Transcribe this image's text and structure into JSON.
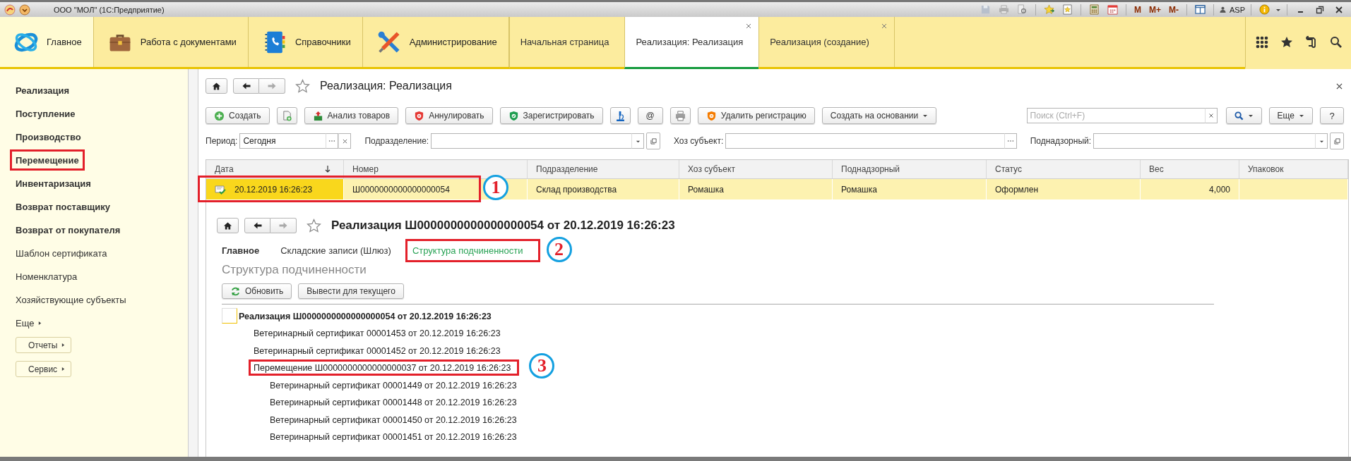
{
  "title_bar": {
    "title": "ООО \"МОЛ\"  (1С:Предприятие)",
    "memory_buttons": [
      "M",
      "M+",
      "M-"
    ],
    "user": "ASP"
  },
  "sections": [
    {
      "label": "Главное",
      "kind": "logo",
      "selected": true
    },
    {
      "label": "Работа с документами",
      "kind": "briefcase",
      "selected": false
    },
    {
      "label": "Справочники",
      "kind": "book",
      "selected": false
    },
    {
      "label": "Администрирование",
      "kind": "tools",
      "selected": false
    }
  ],
  "open_tabs": [
    {
      "label": "Начальная страница",
      "selected": false,
      "closable": false
    },
    {
      "label": "Реализация: Реализация",
      "selected": true,
      "closable": true
    },
    {
      "label": "Реализация (создание)",
      "selected": false,
      "closable": true
    }
  ],
  "sidebar": {
    "items": [
      {
        "label": "Реализация",
        "bold": true,
        "outlined": false
      },
      {
        "label": "Поступление",
        "bold": true,
        "outlined": false
      },
      {
        "label": "Производство",
        "bold": true,
        "outlined": false
      },
      {
        "label": "Перемещение",
        "bold": true,
        "outlined": true
      },
      {
        "label": "Инвентаризация",
        "bold": true,
        "outlined": false
      },
      {
        "label": "Возврат поставщику",
        "bold": true,
        "outlined": false
      },
      {
        "label": "Возврат от покупателя",
        "bold": true,
        "outlined": false
      },
      {
        "label": "Шаблон сертификата",
        "bold": false,
        "outlined": false
      },
      {
        "label": "Номенклатура",
        "bold": false,
        "outlined": false
      },
      {
        "label": "Хозяйствующие субъекты",
        "bold": false,
        "outlined": false
      }
    ],
    "more": "Еще",
    "buttons": [
      "Отчеты",
      "Сервис"
    ]
  },
  "list_form": {
    "title": "Реализация: Реализация",
    "favorite": false,
    "toolbar": [
      {
        "kind": "create",
        "label": "Создать"
      },
      {
        "kind": "copy"
      },
      {
        "kind": "analysis",
        "label": "Анализ товаров"
      },
      {
        "kind": "cancel",
        "label": "Аннулировать"
      },
      {
        "kind": "register",
        "label": "Зарегистрировать"
      },
      {
        "kind": "microscope"
      },
      {
        "kind": "text",
        "label": "@"
      },
      {
        "kind": "print"
      },
      {
        "kind": "unregister",
        "label": "Удалить регистрацию"
      },
      {
        "kind": "menu",
        "label": "Создать на основании"
      }
    ],
    "search": {
      "placeholder": "Поиск (Ctrl+F)"
    },
    "more_button": "Еще",
    "help_button": "?",
    "filters": [
      {
        "label": "Период:",
        "value": "Сегодня",
        "kind": "choice"
      },
      {
        "label": "Подразделение:",
        "kind": "dropdown"
      },
      {
        "label": "Хоз субъект:",
        "kind": "choice"
      },
      {
        "label": "Поднадзорный:",
        "kind": "dropdown"
      }
    ],
    "table": {
      "columns": [
        {
          "label": "Дата",
          "sorted_descending": true
        },
        {
          "label": "Номер"
        },
        {
          "label": "Подразделение"
        },
        {
          "label": "Хоз субъект"
        },
        {
          "label": "Поднадзорный"
        },
        {
          "label": "Статус"
        },
        {
          "label": "Вес",
          "kind": "number"
        },
        {
          "label": "Упаковок",
          "kind": "number"
        }
      ],
      "rows": [
        {
          "selected": true,
          "posted": true,
          "callout": "1",
          "cells": [
            {
              "text": "20.12.2019 16:26:23",
              "current": true
            },
            {
              "text": "Ш0000000000000000054",
              "current": false
            },
            {
              "text": "Склад производства",
              "current": false
            },
            {
              "text": "Ромашка",
              "current": false
            },
            {
              "text": "Ромашка",
              "current": false
            },
            {
              "text": "Оформлен",
              "current": false
            },
            {
              "text": "4,000",
              "current": false
            },
            {
              "current": false
            }
          ]
        }
      ]
    }
  },
  "document_form": {
    "title": "Реализация Ш0000000000000000054 от 20.12.2019 16:26:23",
    "favorite": false,
    "nav": [
      {
        "label": "Главное",
        "bold": true,
        "selected": false,
        "outlined": false
      },
      {
        "label": "Складские записи (Шлюз)",
        "bold": false,
        "selected": false,
        "outlined": false
      },
      {
        "label": "Структура подчиненности",
        "bold": false,
        "selected": true,
        "outlined": true,
        "callout": "2"
      }
    ],
    "heading": "Структура подчиненности",
    "buttons": [
      {
        "kind": "refresh",
        "label": "Обновить"
      },
      {
        "kind": "plain",
        "label": "Вывести для текущего"
      }
    ],
    "tree": [
      {
        "label": "Реализация Ш0000000000000000054 от 20.12.2019 16:26:23",
        "current": true,
        "outlined": false,
        "children": [
          {
            "label": "Ветеринарный сертификат 00001453 от 20.12.2019 16:26:23",
            "current": false,
            "outlined": false
          },
          {
            "label": "Ветеринарный сертификат 00001452 от 20.12.2019 16:26:23",
            "current": false,
            "outlined": false
          },
          {
            "label": "Перемещение Ш0000000000000000037 от 20.12.2019 16:26:23",
            "current": false,
            "outlined": true,
            "callout": "3",
            "children": [
              {
                "label": "Ветеринарный сертификат 00001449 от 20.12.2019 16:26:23",
                "current": false,
                "outlined": false
              },
              {
                "label": "Ветеринарный сертификат 00001448 от 20.12.2019 16:26:23",
                "current": false,
                "outlined": false
              },
              {
                "label": "Ветеринарный сертификат 00001450 от 20.12.2019 16:26:23",
                "current": false,
                "outlined": false
              },
              {
                "label": "Ветеринарный сертификат 00001451 от 20.12.2019 16:26:23",
                "current": false,
                "outlined": false
              }
            ]
          }
        ]
      }
    ]
  }
}
